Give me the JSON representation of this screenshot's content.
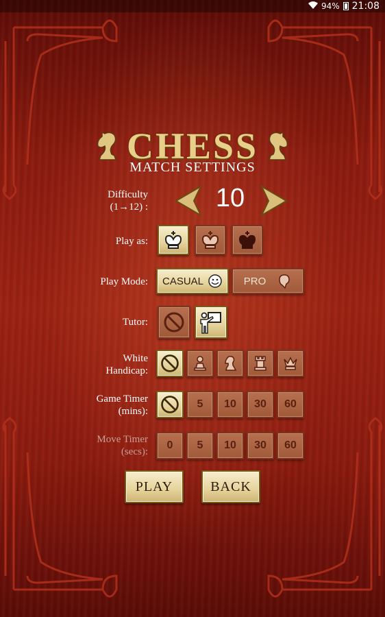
{
  "status": {
    "battery": "94%",
    "time": "21:08"
  },
  "title": "CHESS",
  "subtitle": "MATCH SETTINGS",
  "difficulty": {
    "label_line1": "Difficulty",
    "label_line2": "(1→12) :",
    "value": "10"
  },
  "play_as": {
    "label": "Play as:"
  },
  "play_mode": {
    "label": "Play Mode:",
    "casual": "CASUAL",
    "pro": "PRO"
  },
  "tutor": {
    "label": "Tutor:"
  },
  "handicap": {
    "label_line1": "White",
    "label_line2": "Handicap:"
  },
  "game_timer": {
    "label_line1": "Game Timer",
    "label_line2": "(mins):",
    "options": [
      "5",
      "10",
      "30",
      "60"
    ]
  },
  "move_timer": {
    "label_line1": "Move Timer",
    "label_line2": "(secs):",
    "options": [
      "0",
      "5",
      "10",
      "30",
      "60"
    ]
  },
  "actions": {
    "play": "PLAY",
    "back": "BACK"
  },
  "colors": {
    "gold": "#e8d08a",
    "selected_bg": "#e6d39b",
    "unselected_bg": "#a05a3a",
    "wood": "#8a1a0e"
  }
}
